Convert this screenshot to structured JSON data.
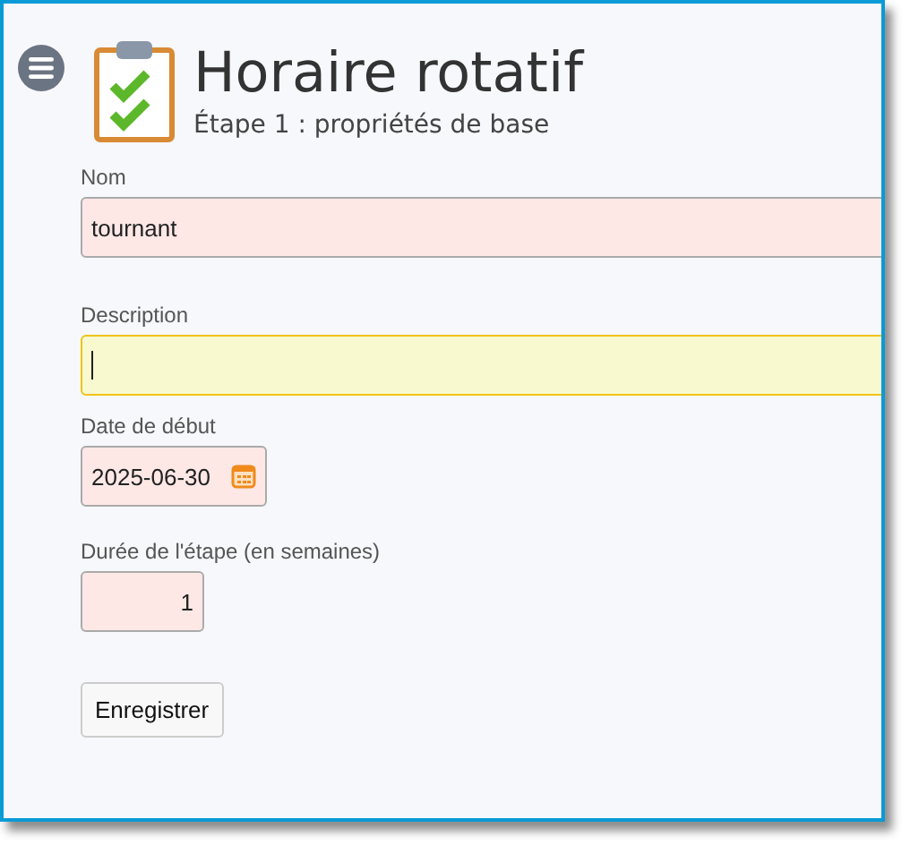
{
  "header": {
    "title": "Horaire rotatif",
    "subtitle": "Étape 1 : propriétés de base"
  },
  "fields": [
    {
      "kind": "text",
      "label": "Nom",
      "value": "tournant",
      "focused": false
    },
    {
      "kind": "text",
      "label": "Description",
      "focused": true
    },
    {
      "kind": "date",
      "label": "Date de début",
      "value": "2025-06-30",
      "focused": false
    },
    {
      "kind": "number",
      "label": "Durée de l'étape (en semaines)",
      "value": "1",
      "focused": false
    }
  ],
  "buttons": [
    "Enregistrer"
  ]
}
